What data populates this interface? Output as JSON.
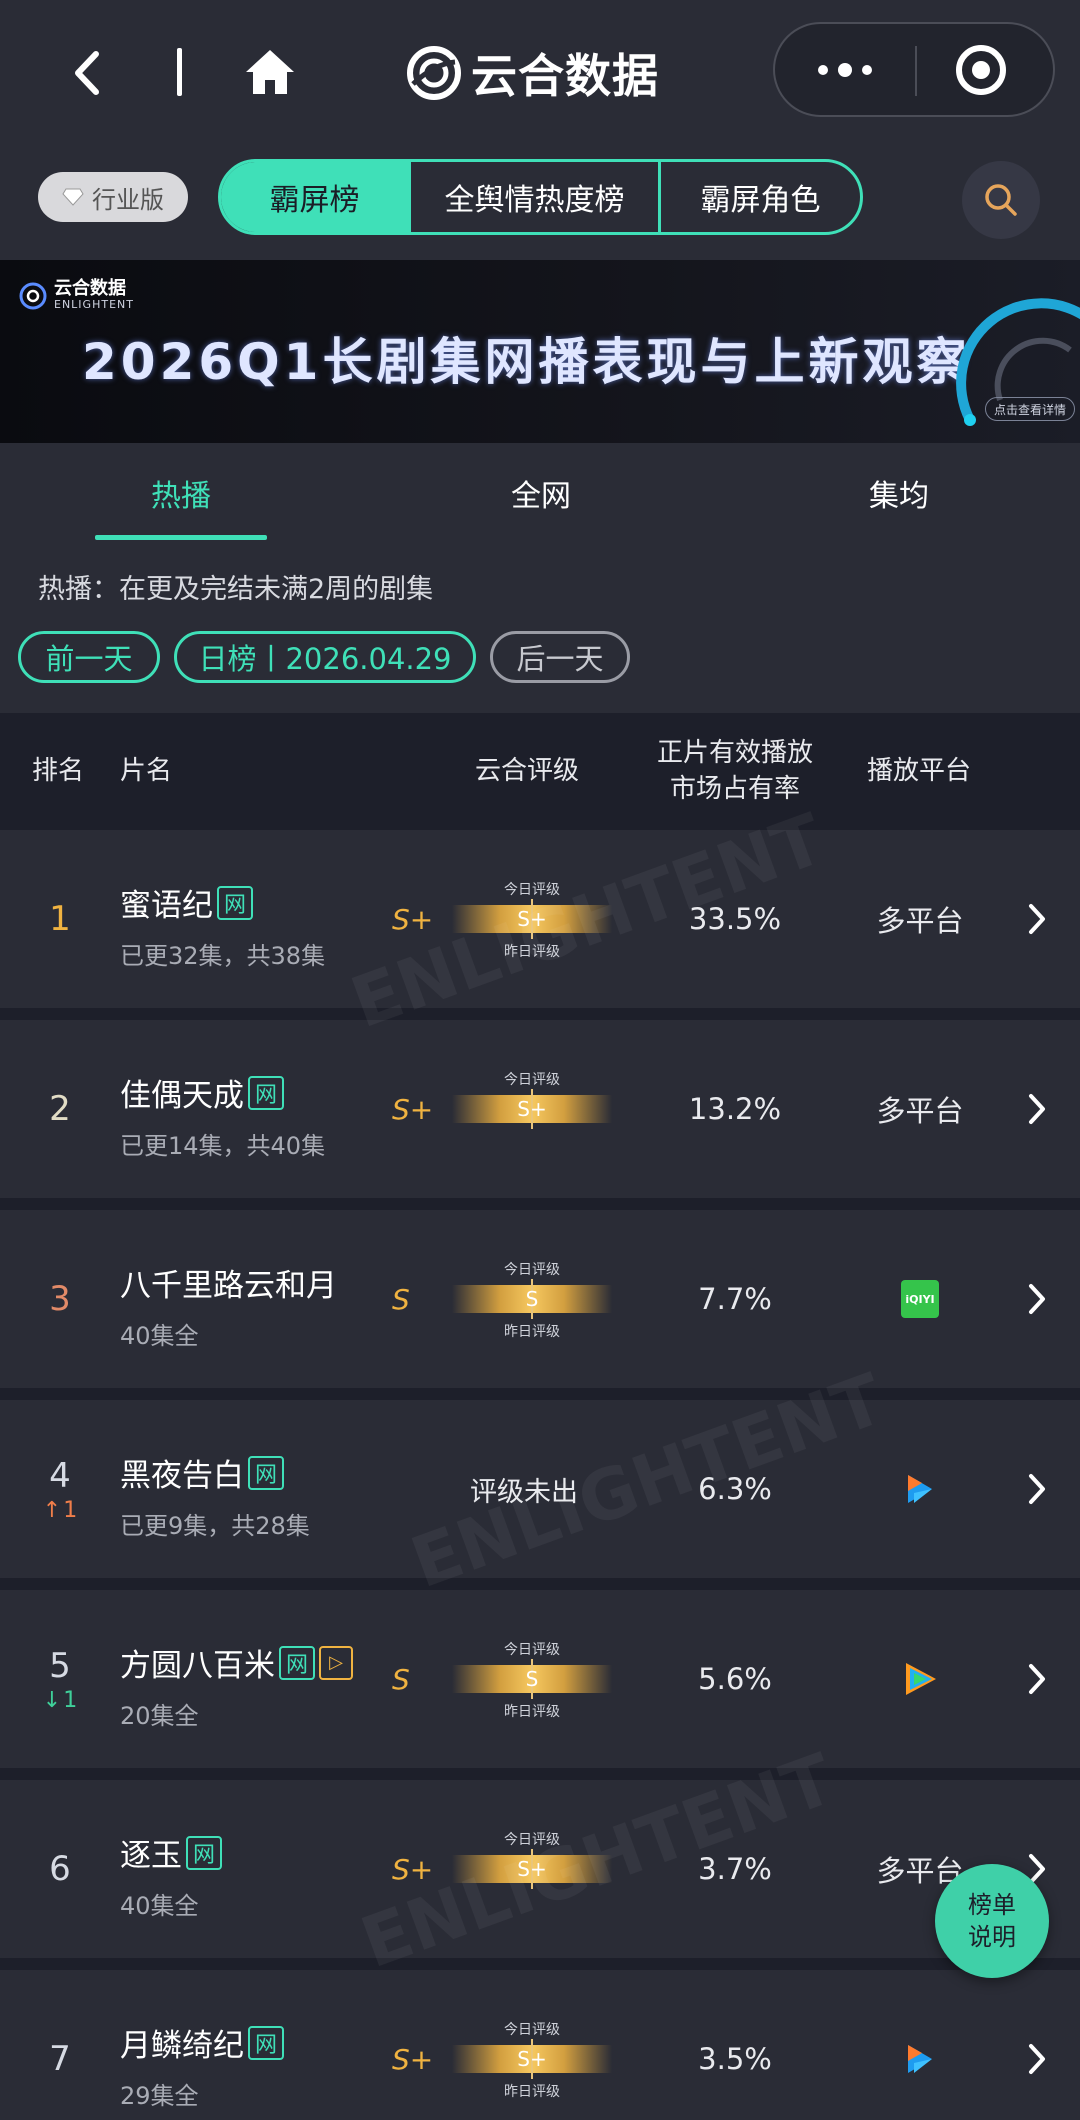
{
  "nav": {
    "brand": "云合数据"
  },
  "tabbar": {
    "industry_badge": "行业版",
    "segments": [
      "霸屏榜",
      "全舆情热度榜",
      "霸屏角色"
    ]
  },
  "banner": {
    "logo_text": "云合数据",
    "logo_sub": "ENLIGHTENT",
    "title": "2026Q1长剧集网播表现与上新观察",
    "tag": "点击查看详情"
  },
  "subtabs": [
    "热播",
    "全网",
    "集均"
  ],
  "filter": {
    "hint": "热播：在更及完结未满2周的剧集",
    "prev": "前一天",
    "current": "日榜丨2026.04.29",
    "next": "后一天"
  },
  "table": {
    "headers": {
      "rank": "排名",
      "title": "片名",
      "grade": "云合评级",
      "share_l1": "正片有效播放",
      "share_l2": "市场占有率",
      "platform": "播放平台"
    },
    "today_label": "今日评级",
    "yesterday_label": "昨日评级",
    "rows": [
      {
        "rank": "1",
        "change": "",
        "title": "蜜语纪",
        "net": "网",
        "extra": "",
        "episodes": "已更32集，共38集",
        "grade": "S+",
        "today": "S+",
        "yesterday_shown": true,
        "no_grade": "",
        "share": "33.5%",
        "platform": "多平台",
        "platform_icon": ""
      },
      {
        "rank": "2",
        "change": "",
        "title": "佳偶天成",
        "net": "网",
        "extra": "",
        "episodes": "已更14集，共40集",
        "grade": "S+",
        "today": "S+",
        "yesterday_shown": false,
        "no_grade": "",
        "share": "13.2%",
        "platform": "多平台",
        "platform_icon": ""
      },
      {
        "rank": "3",
        "change": "",
        "title": "八千里路云和月",
        "net": "",
        "extra": "",
        "episodes": "40集全",
        "grade": "S",
        "today": "S",
        "yesterday_shown": true,
        "no_grade": "",
        "share": "7.7%",
        "platform": "",
        "platform_icon": "iqiyi-icon"
      },
      {
        "rank": "4",
        "change": "1",
        "change_dir": "up",
        "title": "黑夜告白",
        "net": "网",
        "extra": "",
        "episodes": "已更9集，共28集",
        "grade": "",
        "today": "",
        "yesterday_shown": false,
        "no_grade": "评级未出",
        "share": "6.3%",
        "platform": "",
        "platform_icon": "youku-icon"
      },
      {
        "rank": "5",
        "change": "1",
        "change_dir": "down",
        "title": "方圆八百米",
        "net": "网",
        "extra": "▷",
        "episodes": "20集全",
        "grade": "S",
        "today": "S",
        "yesterday_shown": true,
        "no_grade": "",
        "share": "5.6%",
        "platform": "",
        "platform_icon": "tencent-video-icon"
      },
      {
        "rank": "6",
        "change": "",
        "title": "逐玉",
        "net": "网",
        "extra": "",
        "episodes": "40集全",
        "grade": "S+",
        "today": "S+",
        "yesterday_shown": false,
        "no_grade": "",
        "share": "3.7%",
        "platform": "多平台",
        "platform_icon": ""
      },
      {
        "rank": "7",
        "change": "",
        "title": "月鳞绮纪",
        "net": "网",
        "extra": "",
        "episodes": "29集全",
        "grade": "S+",
        "today": "S+",
        "yesterday_shown": true,
        "no_grade": "",
        "share": "3.5%",
        "platform": "",
        "platform_icon": "youku-icon"
      }
    ]
  },
  "fab": {
    "line1": "榜单",
    "line2": "说明"
  },
  "colors": {
    "accent": "#3fe0b8",
    "gold": "#f0b341",
    "bg": "#1d1f2a",
    "panel": "#2a2c36"
  }
}
